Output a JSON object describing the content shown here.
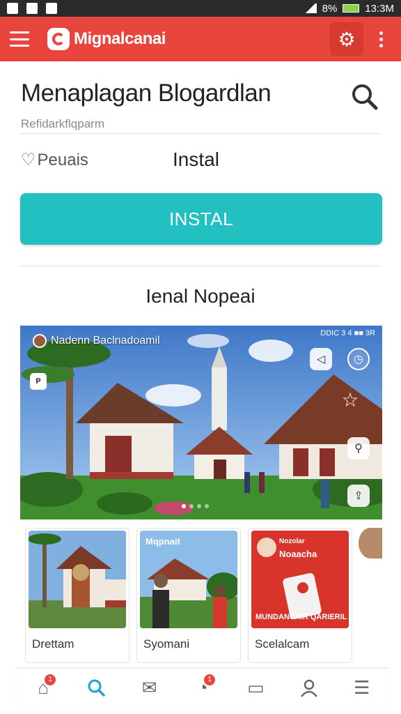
{
  "status_bar": {
    "time": "13:3M",
    "battery": "8%"
  },
  "app_bar": {
    "title": "Mignalcanai",
    "icons": [
      "menu-icon",
      "gear-icon",
      "more-vert-icon"
    ]
  },
  "header": {
    "title": "Menaplagan Blogardlan",
    "subtitle": "Refidarkflqparm"
  },
  "install_row": {
    "rating_label": "Peuais",
    "install_label": "Instal",
    "install_button": "INSTAL"
  },
  "section": {
    "title": "Ienal Nopeai"
  },
  "hero": {
    "caption": "Nadenn Baclnadoamil",
    "status": "DDIC 3 4 ■■ 3R",
    "active_slide": 1,
    "slide_count": 4
  },
  "cards": [
    {
      "label": "Drettam"
    },
    {
      "label": "Syomani",
      "overlay": "Mqpnait"
    },
    {
      "label": "Scelalcam",
      "overlay_lines": [
        "Nozolar",
        "Noaacha"
      ],
      "bottom_text": "MUNDANCAIR QARIERIL"
    }
  ],
  "bottom_nav": {
    "items": [
      {
        "icon": "home-icon",
        "badge": "1"
      },
      {
        "icon": "search-icon",
        "active": true
      },
      {
        "icon": "mail-icon"
      },
      {
        "icon": "chat-icon",
        "badge": "1"
      },
      {
        "icon": "book-icon"
      },
      {
        "icon": "profile-icon"
      },
      {
        "icon": "menu-icon"
      }
    ]
  },
  "colors": {
    "app_bar": "#e8453c",
    "install_button": "#22c0c0",
    "nav_active": "#1ea0d8"
  }
}
